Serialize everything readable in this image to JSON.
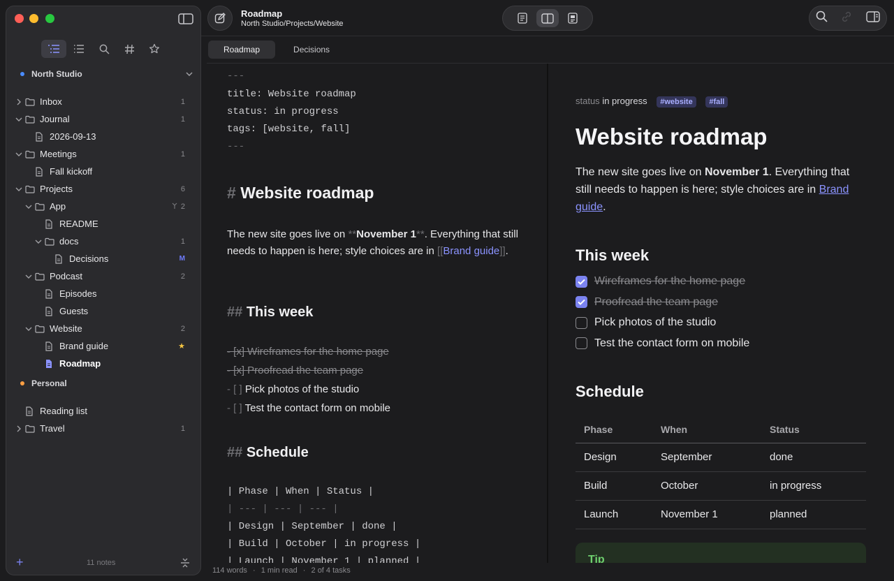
{
  "window": {
    "title": "Roadmap",
    "path": "North Studio/Projects/Website"
  },
  "sidebar": {
    "workspaces": [
      {
        "name": "North Studio",
        "color": "#4a8cff"
      },
      {
        "name": "Personal",
        "color": "#ff9f43"
      }
    ],
    "tree": [
      {
        "label": "Inbox",
        "count": "1"
      },
      {
        "label": "Journal",
        "count": "1"
      },
      {
        "label": "2026-09-13",
        "count": ""
      },
      {
        "label": "Meetings",
        "count": "1"
      },
      {
        "label": "Fall kickoff",
        "count": ""
      },
      {
        "label": "Projects",
        "count": "6"
      },
      {
        "label": "App",
        "count": "2"
      },
      {
        "label": "README",
        "count": ""
      },
      {
        "label": "docs",
        "count": "1"
      },
      {
        "label": "Decisions",
        "count": "M"
      },
      {
        "label": "Podcast",
        "count": "2"
      },
      {
        "label": "Episodes",
        "count": ""
      },
      {
        "label": "Guests",
        "count": ""
      },
      {
        "label": "Website",
        "count": "2"
      },
      {
        "label": "Brand guide",
        "count": "★"
      },
      {
        "label": "Roadmap",
        "count": ""
      },
      {
        "label": "Reading list",
        "count": ""
      },
      {
        "label": "Travel",
        "count": "1"
      }
    ],
    "footer": {
      "notes_count": "11 notes",
      "add_label": "+"
    }
  },
  "tabs": [
    "Roadmap",
    "Decisions"
  ],
  "editor": {
    "fm_open": "---",
    "fm_title": "title: Website roadmap",
    "fm_status": "status: in progress",
    "fm_tags": "tags: [website, fall]",
    "fm_close": "---",
    "h1_mark": "#",
    "h1_text": "Website roadmap",
    "p_a": "The new site goes live on ",
    "p_b": "**",
    "p_c": "November 1",
    "p_d": "**",
    "p_e": ". Everything that still needs to happen is here; style choices are in ",
    "p_f": "[[",
    "p_g": "Brand guide",
    "p_h": "]]",
    "p_i": ".",
    "h2_mark": "##",
    "h2a_text": "This week",
    "t1": "- [x] Wireframes for the home page",
    "t2": "- [x] Proofread the team page",
    "t3_mark": "- [ ]",
    "t3_text": " Pick photos of the studio",
    "t4_mark": "- [ ]",
    "t4_text": " Test the contact form on mobile",
    "h2b_text": "Schedule",
    "tbl1": "| Phase | When | Status |",
    "tbl2": "| --- | --- | --- |",
    "tbl3": "| Design | September | done |",
    "tbl4": "| Build | October | in progress |",
    "tbl5": "| Launch | November 1 | planned |"
  },
  "preview": {
    "status_key": "status",
    "status_val": "in progress",
    "tags": [
      "#website",
      "#fall"
    ],
    "h1": "Website roadmap",
    "p_a": "The new site goes live on ",
    "p_b": "November 1",
    "p_c": ". Everything that still needs to happen is here; style choices are in ",
    "p_link": "Brand guide",
    "p_end": ".",
    "h2a": "This week",
    "tasks": [
      {
        "text": "Wireframes for the home page",
        "done": true
      },
      {
        "text": "Proofread the team page",
        "done": true
      },
      {
        "text": "Pick photos of the studio",
        "done": false
      },
      {
        "text": "Test the contact form on mobile",
        "done": false
      }
    ],
    "h2b": "Schedule",
    "table": {
      "headers": [
        "Phase",
        "When",
        "Status"
      ],
      "rows": [
        [
          "Design",
          "September",
          "done"
        ],
        [
          "Build",
          "October",
          "in progress"
        ],
        [
          "Launch",
          "November 1",
          "planned"
        ]
      ]
    },
    "tip_label": "Tip"
  },
  "statusbar": {
    "words": "114 words",
    "read": "1 min read",
    "tasks": "2 of 4 tasks",
    "sep": "·"
  },
  "colors": {
    "accent": "#8b93ff",
    "star": "#f5c542",
    "modified": "#6f7cff"
  }
}
